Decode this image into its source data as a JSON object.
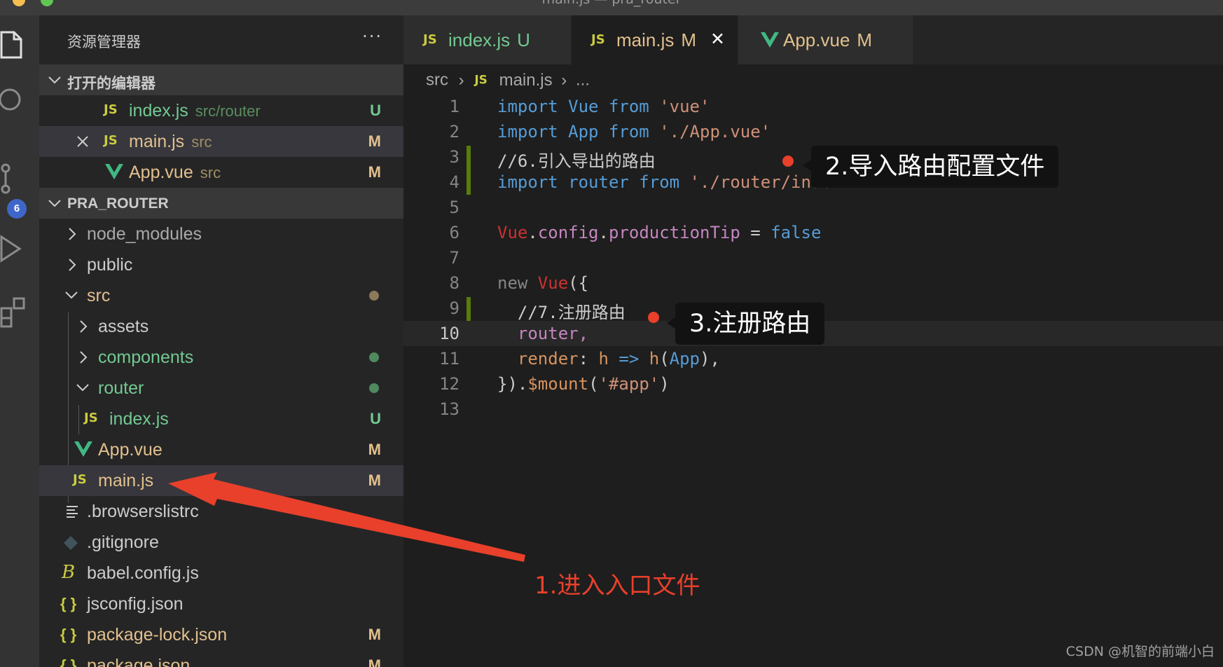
{
  "window": {
    "title": "main.js — pra_router"
  },
  "activity_bar": {
    "scm_badge": "6"
  },
  "sidebar": {
    "title": "资源管理器",
    "more": "···",
    "open_editors": {
      "title": "打开的编辑器",
      "items": [
        {
          "icon": "JS",
          "name": "index.js",
          "desc": "src/router",
          "status": "U"
        },
        {
          "icon": "JS",
          "name": "main.js",
          "desc": "src",
          "status": "M"
        },
        {
          "icon": "V",
          "name": "App.vue",
          "desc": "src",
          "status": "M"
        }
      ]
    },
    "project": {
      "title": "PRA_ROUTER",
      "items": [
        {
          "name": "node_modules"
        },
        {
          "name": "public"
        },
        {
          "name": "src"
        },
        {
          "name": "assets"
        },
        {
          "name": "components"
        },
        {
          "name": "router"
        },
        {
          "icon": "JS",
          "name": "index.js",
          "status": "U"
        },
        {
          "icon": "V",
          "name": "App.vue",
          "status": "M"
        },
        {
          "icon": "JS",
          "name": "main.js",
          "status": "M"
        },
        {
          "name": ".browserslistrc"
        },
        {
          "name": ".gitignore"
        },
        {
          "name": "babel.config.js"
        },
        {
          "icon": "{ }",
          "name": "jsconfig.json"
        },
        {
          "icon": "{ }",
          "name": "package-lock.json",
          "status": "M"
        },
        {
          "icon": "{ }",
          "name": "package.json",
          "status": "M"
        }
      ]
    }
  },
  "tabs": [
    {
      "icon": "JS",
      "label": "index.js",
      "status": "U"
    },
    {
      "icon": "JS",
      "label": "main.js",
      "status": "M",
      "close": "✕"
    },
    {
      "icon": "V",
      "label": "App.vue",
      "status": "M"
    }
  ],
  "breadcrumb": {
    "folder": "src",
    "sep": "›",
    "icon": "JS",
    "file": "main.js",
    "more": "..."
  },
  "code": {
    "line_numbers": [
      "1",
      "2",
      "3",
      "4",
      "5",
      "6",
      "7",
      "8",
      "9",
      "10",
      "11",
      "12",
      "13"
    ],
    "l1": {
      "a": "import",
      "b": " Vue ",
      "c": "from",
      "d": " 'vue'"
    },
    "l2": {
      "a": "import",
      "b": " App ",
      "c": "from",
      "d": " './App.vue'"
    },
    "l3": "//6.引入导出的路由",
    "l4": {
      "a": "import",
      "b": " router ",
      "c": "from",
      "d": " './router/index'"
    },
    "l6": {
      "a": "Vue",
      "b": ".",
      "c": "config",
      "d": ".",
      "e": "productionTip",
      "f": " = ",
      "g": "false"
    },
    "l8": {
      "a": "new ",
      "b": "Vue",
      "c": "({"
    },
    "l9": "  //7.注册路由",
    "l10": "  router,",
    "l11": {
      "a": "  render",
      "b": ": ",
      "c": "h",
      "d": " => ",
      "e": "h",
      "f": "(",
      "g": "App",
      "h": "),"
    },
    "l12": {
      "a": "})",
      "b": ".",
      "c": "$mount",
      "d": "(",
      "e": "'#app'",
      "f": ")"
    }
  },
  "annotations": {
    "step1": "1.进入入口文件",
    "step2": "2.导入路由配置文件",
    "step3": "3.注册路由",
    "arrow_color": "#e8402b"
  },
  "watermark": "CSDN @机智的前端小白"
}
